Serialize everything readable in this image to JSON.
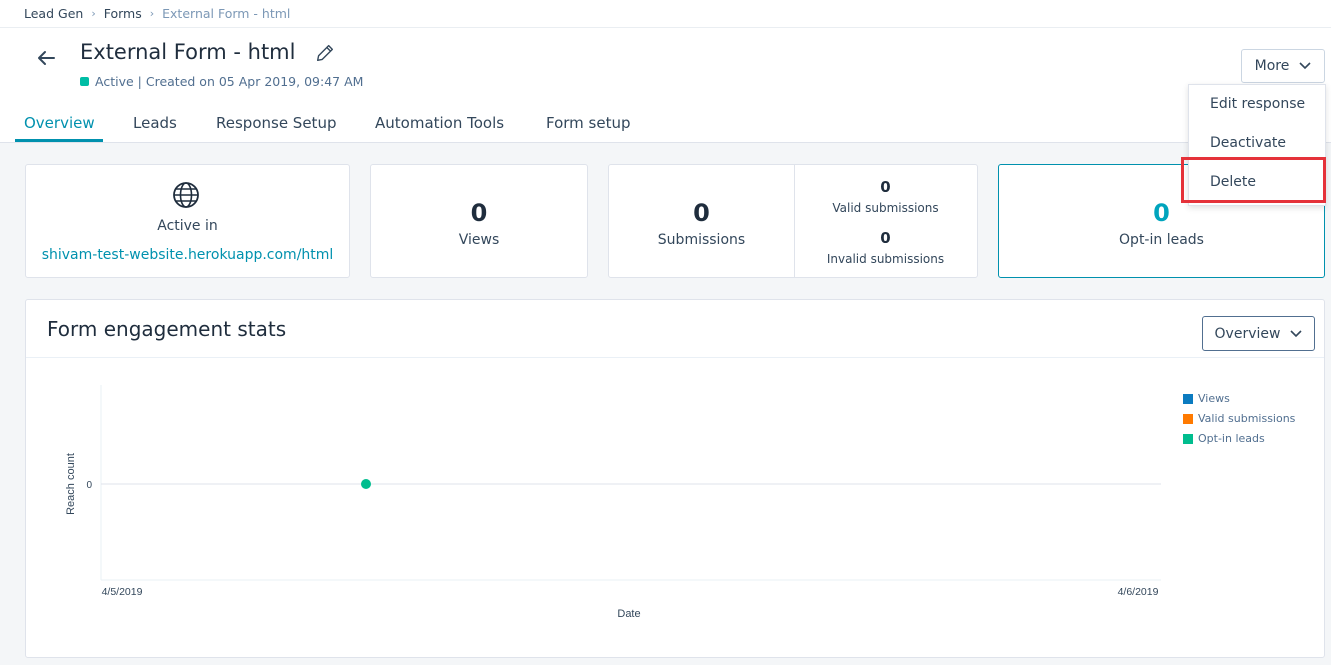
{
  "breadcrumb": {
    "items": [
      "Lead Gen",
      "Forms"
    ],
    "current": "External Form - html",
    "separator": "›"
  },
  "header": {
    "title": "External Form - html",
    "status": "Active",
    "created": "| Created on 05 Apr 2019, 09:47 AM",
    "more_label": "More"
  },
  "tabs": [
    "Overview",
    "Leads",
    "Response Setup",
    "Automation Tools",
    "Form setup"
  ],
  "more_menu": [
    "Edit response",
    "Deactivate",
    "Delete"
  ],
  "cards": {
    "active_in": {
      "label": "Active in",
      "website": "shivam-test-website.herokuapp.com/html"
    },
    "views": {
      "value": "0",
      "label": "Views"
    },
    "submissions": {
      "value": "0",
      "label": "Submissions",
      "valid_value": "0",
      "valid_label": "Valid submissions",
      "invalid_value": "0",
      "invalid_label": "Invalid submissions"
    },
    "optin": {
      "value": "0",
      "label": "Opt-in leads"
    }
  },
  "stats": {
    "title": "Form engagement stats",
    "select_value": "Overview"
  },
  "colors": {
    "accent": "#0091ae",
    "views": "#0b7bc0",
    "valid": "#ff7a00",
    "optin": "#00bd8e",
    "delete_highlight": "#e5323a"
  },
  "chart_data": {
    "type": "line",
    "x": [
      "4/5/2019",
      "4/6/2019"
    ],
    "xlabel": "Date",
    "ylabel": "Reach count",
    "yticks": [
      "0"
    ],
    "series": [
      {
        "name": "Views",
        "color": "#0b7bc0",
        "points": []
      },
      {
        "name": "Valid submissions",
        "color": "#ff7a00",
        "points": []
      },
      {
        "name": "Opt-in leads",
        "color": "#00bd8e",
        "points": [
          {
            "x": "4/5/2019 06:00",
            "y": 0
          }
        ]
      }
    ],
    "grid": true,
    "legend": "top-right"
  }
}
